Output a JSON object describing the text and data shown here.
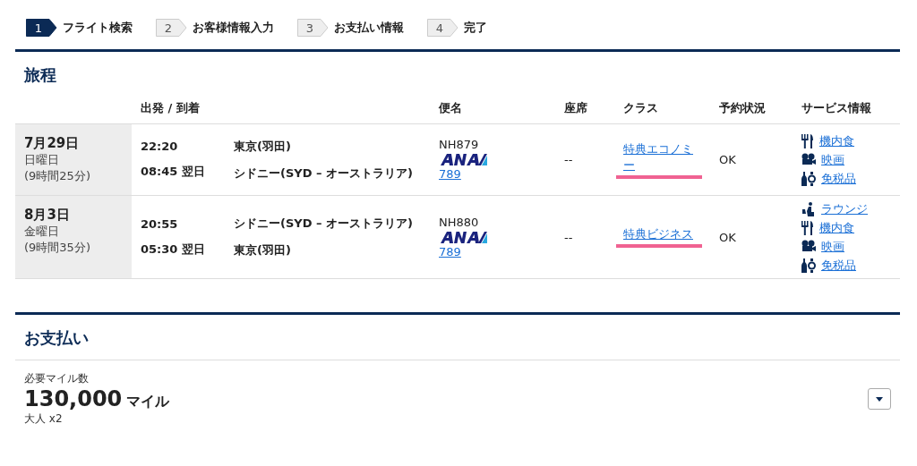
{
  "steps": [
    {
      "number": "1",
      "label": "フライト検索",
      "selected": true
    },
    {
      "number": "2",
      "label": "お客様情報入力",
      "selected": false
    },
    {
      "number": "3",
      "label": "お支払い情報",
      "selected": false
    },
    {
      "number": "4",
      "label": "完了",
      "selected": false
    }
  ],
  "itinerary": {
    "title": "旅程",
    "columns": [
      "出発 / 到着",
      "便名",
      "座席",
      "クラス",
      "予約状況",
      "サービス情報"
    ],
    "rows": [
      {
        "date": "7月29日",
        "weekday": "日曜日",
        "duration": "(9時間25分)",
        "departure_time": "22:20",
        "departure_place": "東京(羽田)",
        "arrival_time": "08:45 翌日",
        "arrival_place": "シドニー(SYD – オーストラリア)",
        "flight": "NH879",
        "aircraft": "789",
        "seat": "--",
        "class": "特典エコノミー",
        "class_marked": true,
        "status": "OK",
        "services": [
          {
            "kind": "meal",
            "label": "機内食"
          },
          {
            "kind": "movie",
            "label": "映画"
          },
          {
            "kind": "dutyfree",
            "label": "免税品"
          }
        ]
      },
      {
        "date": "8月3日",
        "weekday": "金曜日",
        "duration": "(9時間35分)",
        "departure_time": "20:55",
        "departure_place": "シドニー(SYD – オーストラリア)",
        "arrival_time": "05:30 翌日",
        "arrival_place": "東京(羽田)",
        "flight": "NH880",
        "aircraft": "789",
        "seat": "--",
        "class": "特典ビジネス",
        "class_marked": true,
        "status": "OK",
        "services": [
          {
            "kind": "lounge",
            "label": "ラウンジ"
          },
          {
            "kind": "meal",
            "label": "機内食"
          },
          {
            "kind": "movie",
            "label": "映画"
          },
          {
            "kind": "dutyfree",
            "label": "免税品"
          }
        ]
      }
    ]
  },
  "payment": {
    "title": "お支払い",
    "label": "必要マイル数",
    "amount": "130,000",
    "unit": "マイル",
    "passengers": "大人 x2"
  }
}
